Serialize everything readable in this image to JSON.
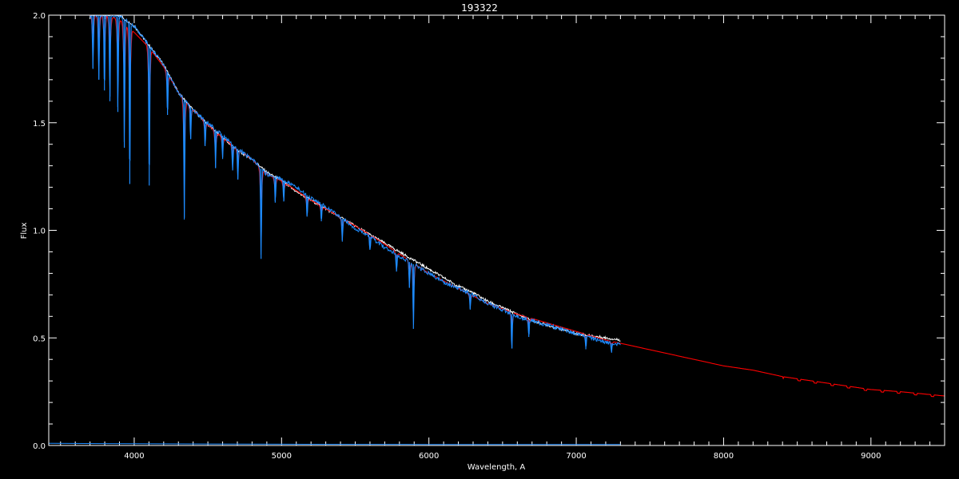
{
  "chart_data": {
    "type": "line",
    "title": "193322",
    "xlabel": "Wavelength, A",
    "ylabel": "Flux",
    "xlim": [
      3420,
      9500
    ],
    "ylim": [
      0.0,
      2.0
    ],
    "x_ticks": [
      4000,
      5000,
      6000,
      7000,
      8000,
      9000
    ],
    "x_tick_labels": [
      "4000",
      "5000",
      "6000",
      "7000",
      "8000",
      "9000"
    ],
    "y_ticks": [
      0.0,
      0.5,
      1.0,
      1.5,
      2.0
    ],
    "y_tick_labels": [
      "0.0",
      "0.5",
      "1.0",
      "1.5",
      "2.0"
    ],
    "grid": false,
    "legend": "none",
    "series": [
      {
        "style": "observed-spectrum",
        "color": "#ffffff",
        "x": [
          3700,
          3800,
          3900,
          4000,
          4100,
          4200,
          4300,
          4400,
          4500,
          4600,
          4700,
          4800,
          4900,
          5000,
          5100,
          5200,
          5300,
          5400,
          5500,
          5600,
          5700,
          5800,
          5900,
          6000,
          6100,
          6200,
          6300,
          6400,
          6500,
          6600,
          6700,
          6800,
          6900,
          7000,
          7100,
          7200,
          7300
        ],
        "y": [
          2.0,
          2.0,
          2.0,
          1.95,
          1.86,
          1.77,
          1.64,
          1.56,
          1.49,
          1.43,
          1.37,
          1.33,
          1.27,
          1.23,
          1.18,
          1.14,
          1.1,
          1.06,
          1.02,
          0.98,
          0.94,
          0.9,
          0.86,
          0.82,
          0.78,
          0.74,
          0.71,
          0.67,
          0.64,
          0.61,
          0.58,
          0.56,
          0.54,
          0.52,
          0.51,
          0.5,
          0.49
        ]
      },
      {
        "style": "model-spectrum",
        "color": "#ff0000",
        "x": [
          3700,
          3800,
          3900,
          4000,
          4100,
          4200,
          4300,
          4400,
          4500,
          4600,
          4700,
          4800,
          4900,
          5000,
          5200,
          5400,
          5600,
          5800,
          6000,
          6200,
          6400,
          6600,
          6800,
          7000,
          7200,
          7400,
          7600,
          7800,
          8000,
          8200,
          8400,
          8600,
          8800,
          9000,
          9200,
          9500
        ],
        "y": [
          2.0,
          2.0,
          1.98,
          1.92,
          1.85,
          1.76,
          1.64,
          1.56,
          1.49,
          1.43,
          1.38,
          1.33,
          1.26,
          1.23,
          1.14,
          1.06,
          0.98,
          0.89,
          0.8,
          0.73,
          0.66,
          0.61,
          0.57,
          0.53,
          0.49,
          0.46,
          0.43,
          0.4,
          0.37,
          0.35,
          0.32,
          0.3,
          0.28,
          0.26,
          0.25,
          0.23
        ]
      },
      {
        "style": "observed-spectrum-absorption",
        "color": "#1e8cff",
        "x": [
          3700,
          3800,
          3900,
          4000,
          4100,
          4200,
          4300,
          4400,
          4500,
          4600,
          4700,
          4800,
          4900,
          5000,
          5100,
          5200,
          5300,
          5400,
          5500,
          5600,
          5700,
          5800,
          5900,
          6000,
          6100,
          6200,
          6300,
          6400,
          6500,
          6600,
          6700,
          6800,
          6900,
          7000,
          7100,
          7200,
          7300
        ],
        "y": [
          2.0,
          2.0,
          2.0,
          1.95,
          1.86,
          1.77,
          1.64,
          1.56,
          1.5,
          1.44,
          1.38,
          1.33,
          1.26,
          1.24,
          1.2,
          1.15,
          1.11,
          1.06,
          1.01,
          0.97,
          0.92,
          0.88,
          0.84,
          0.8,
          0.76,
          0.73,
          0.7,
          0.66,
          0.63,
          0.6,
          0.58,
          0.56,
          0.54,
          0.52,
          0.5,
          0.48,
          0.47
        ]
      },
      {
        "style": "error-spectrum",
        "color": "#1e8cff",
        "x": [
          3420,
          4000,
          5000,
          6000,
          7000,
          7300
        ],
        "y": [
          0.01,
          0.008,
          0.006,
          0.005,
          0.005,
          0.005
        ]
      }
    ],
    "absorption_lines": [
      {
        "x": 3720,
        "depth": 0.25
      },
      {
        "x": 3760,
        "depth": 0.3
      },
      {
        "x": 3798,
        "depth": 0.35
      },
      {
        "x": 3835,
        "depth": 0.4
      },
      {
        "x": 3889,
        "depth": 0.45
      },
      {
        "x": 3933,
        "depth": 0.6
      },
      {
        "x": 3970,
        "depth": 0.75
      },
      {
        "x": 4102,
        "depth": 0.65
      },
      {
        "x": 4226,
        "depth": 0.2
      },
      {
        "x": 4340,
        "depth": 0.55
      },
      {
        "x": 4383,
        "depth": 0.15
      },
      {
        "x": 4481,
        "depth": 0.12
      },
      {
        "x": 4552,
        "depth": 0.18
      },
      {
        "x": 4600,
        "depth": 0.1
      },
      {
        "x": 4668,
        "depth": 0.12
      },
      {
        "x": 4703,
        "depth": 0.14
      },
      {
        "x": 4861,
        "depth": 0.42
      },
      {
        "x": 4957,
        "depth": 0.12
      },
      {
        "x": 5015,
        "depth": 0.1
      },
      {
        "x": 5173,
        "depth": 0.1
      },
      {
        "x": 5270,
        "depth": 0.08
      },
      {
        "x": 5412,
        "depth": 0.1
      },
      {
        "x": 5600,
        "depth": 0.06
      },
      {
        "x": 5780,
        "depth": 0.08
      },
      {
        "x": 5868,
        "depth": 0.12
      },
      {
        "x": 5895,
        "depth": 0.3
      },
      {
        "x": 6280,
        "depth": 0.07
      },
      {
        "x": 6563,
        "depth": 0.16
      },
      {
        "x": 6678,
        "depth": 0.08
      },
      {
        "x": 7065,
        "depth": 0.06
      },
      {
        "x": 7240,
        "depth": 0.04
      }
    ]
  }
}
